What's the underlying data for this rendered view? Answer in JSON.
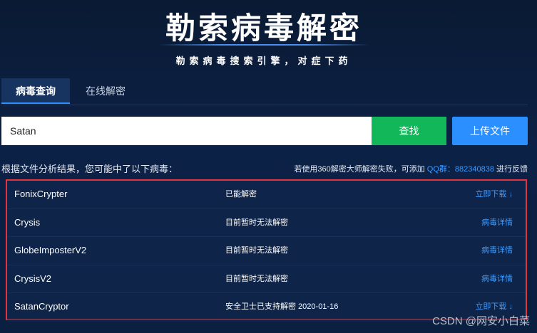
{
  "header": {
    "title": "勒索病毒解密",
    "subtitle": "勒索病毒搜索引擎，对症下药"
  },
  "tabs": [
    {
      "label": "病毒查询",
      "active": true
    },
    {
      "label": "在线解密",
      "active": false
    }
  ],
  "search": {
    "value": "Satan",
    "search_label": "查找",
    "upload_label": "上传文件"
  },
  "results_intro": "根据文件分析结果，您可能中了以下病毒：",
  "feedback": {
    "prefix": "若使用360解密大师解密失败，可添加",
    "qq": "QQ群：882340838",
    "suffix": "进行反馈"
  },
  "results": [
    {
      "name": "FonixCrypter",
      "status": "已能解密",
      "action": "立即下载 ↓"
    },
    {
      "name": "Crysis",
      "status": "目前暂时无法解密",
      "action": "病毒详情"
    },
    {
      "name": "GlobeImposterV2",
      "status": "目前暂时无法解密",
      "action": "病毒详情"
    },
    {
      "name": "CrysisV2",
      "status": "目前暂时无法解密",
      "action": "病毒详情"
    },
    {
      "name": "SatanCryptor",
      "status": "安全卫士已支持解密 2020-01-16",
      "action": "立即下载 ↓"
    }
  ],
  "watermark": "CSDN @网安小白菜",
  "colors": {
    "background": "#0c2146",
    "accent_blue": "#2b8fff",
    "search_green": "#12b759",
    "highlight_border": "#e3353b"
  }
}
